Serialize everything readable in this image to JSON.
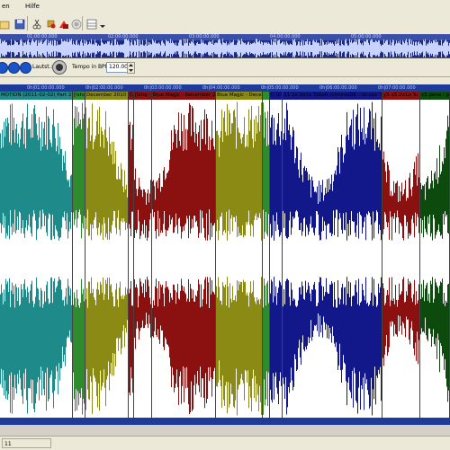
{
  "menu": {
    "items": [
      "en",
      "Hilfe"
    ]
  },
  "toolbar": {
    "icons": [
      "open-icon",
      "save-icon",
      "cut-icon",
      "paint-icon",
      "effect-icon",
      "record-icon",
      "view-icon",
      "dropdown-icon"
    ]
  },
  "overview": {
    "ticks": [
      "01:00:00.000",
      "02:00:00.000",
      "03:00:00.000",
      "04:00:00.000",
      "05:00:00.000"
    ]
  },
  "transport": {
    "loudness_label": "Lautst.:",
    "tempo_label": "Tempo in BPM:",
    "tempo_value": "120.00"
  },
  "ruler": {
    "ticks": [
      "0h|01:00:00.000",
      "0h|02:00:00.000",
      "0h|03:00:00.000",
      "0h|04:00:00.000",
      "0h|05:00:00.000",
      "0h|06:00:00.000",
      "0h|07:00:00.000"
    ]
  },
  "tracks": [
    {
      "title": "MOTION (2011-02-02) Part 2 - Sub",
      "color": "#1f8a8a"
    },
    {
      "title": "[Ishq ",
      "color": "#2e8b2e"
    },
    {
      "title": "December 2010 ",
      "color": "#8a8a14"
    },
    {
      "title": "C",
      "color": "#8b1010"
    },
    {
      "title": "[Ishq - ",
      "color": "#8b1010"
    },
    {
      "title": "Blue Magic - December 2010 ",
      "color": "#8b1010"
    },
    {
      "title": "Blue Magic - Decem",
      "color": "#8a8a14"
    },
    {
      "title": "",
      "color": "#2e8b2e"
    },
    {
      "title": "C:\\D",
      "color": "#12188a"
    },
    {
      "title": "31 1o 2o1o TußoR criminalDE - to-xao 'r.mp3",
      "color": "#12188a"
    },
    {
      "title": "y5 x5 2o1o Tu",
      "color": "#8b1010"
    },
    {
      "title": "v5 pena - pe",
      "color": "#0d4a0d"
    }
  ],
  "status": {
    "text": "11"
  }
}
